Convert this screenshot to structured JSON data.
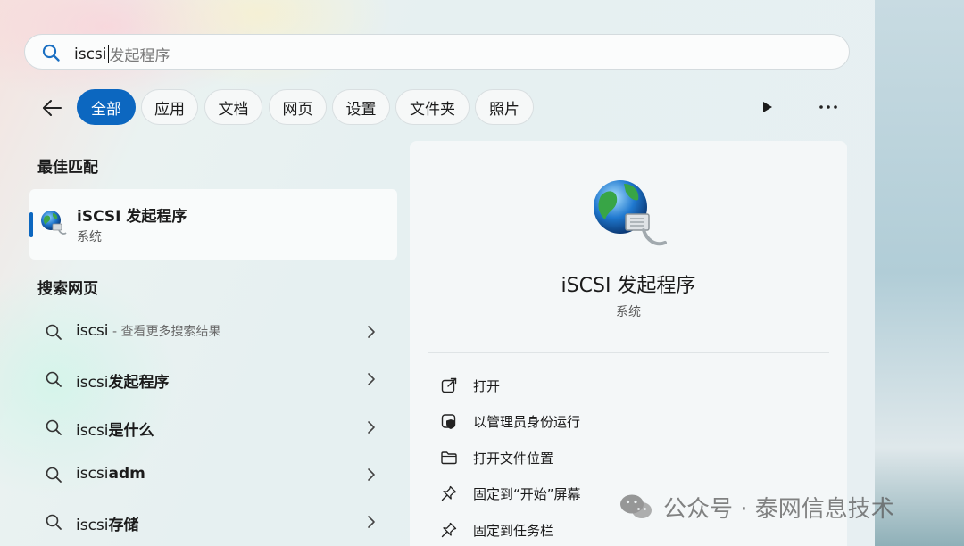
{
  "search": {
    "query": "iscsi",
    "hint": "发起程序"
  },
  "filters": [
    {
      "label": "全部",
      "active": true
    },
    {
      "label": "应用"
    },
    {
      "label": "文档"
    },
    {
      "label": "网页"
    },
    {
      "label": "设置"
    },
    {
      "label": "文件夹"
    },
    {
      "label": "照片"
    }
  ],
  "best_match": {
    "heading": "最佳匹配",
    "title": "iSCSI 发起程序",
    "subtitle": "系统"
  },
  "web_search": {
    "heading": "搜索网页",
    "items": [
      {
        "prefix": "iscsi",
        "suffix": " - 查看更多搜索结果",
        "suffix_style": "muted"
      },
      {
        "prefix": "iscsi",
        "suffix": "发起程序",
        "suffix_style": "bold"
      },
      {
        "prefix": "iscsi",
        "suffix": "是什么",
        "suffix_style": "bold"
      },
      {
        "prefix": "iscsi",
        "suffix": "adm",
        "suffix_style": "bold"
      },
      {
        "prefix": "iscsi",
        "suffix": "存储",
        "suffix_style": "bold"
      }
    ]
  },
  "detail": {
    "title": "iSCSI 发起程序",
    "subtitle": "系统",
    "actions": [
      {
        "label": "打开",
        "icon": "open-external-icon"
      },
      {
        "label": "以管理员身份运行",
        "icon": "shield-admin-icon"
      },
      {
        "label": "打开文件位置",
        "icon": "folder-icon"
      },
      {
        "label": "固定到“开始”屏幕",
        "icon": "pin-icon"
      },
      {
        "label": "固定到任务栏",
        "icon": "pin-icon"
      }
    ]
  },
  "watermark": {
    "text": "公众号 · 泰网信息技术"
  },
  "colors": {
    "accent": "#0c67c0"
  }
}
